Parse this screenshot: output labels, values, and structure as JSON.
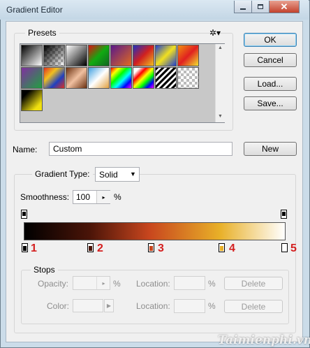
{
  "window": {
    "title": "Gradient Editor"
  },
  "presets": {
    "label": "Presets"
  },
  "buttons": {
    "ok": "OK",
    "cancel": "Cancel",
    "load": "Load...",
    "save": "Save...",
    "new": "New",
    "delete": "Delete"
  },
  "name_field": {
    "label": "Name:",
    "value": "Custom"
  },
  "gradient_type": {
    "label": "Gradient Type:",
    "value": "Solid"
  },
  "smoothness": {
    "label": "Smoothness:",
    "value": "100",
    "unit": "%"
  },
  "stops": {
    "label": "Stops",
    "opacity_label": "Opacity:",
    "color_label": "Color:",
    "location_label": "Location:",
    "unit": "%"
  },
  "stop_numbers": [
    "1",
    "2",
    "3",
    "4",
    "5"
  ],
  "watermark": "Taimienphi.vn",
  "colors": {
    "stop1": "#000000",
    "stop2": "#4a1408",
    "stop3": "#c8461e",
    "stop4": "#e8b028",
    "stop5": "#ffffff"
  }
}
